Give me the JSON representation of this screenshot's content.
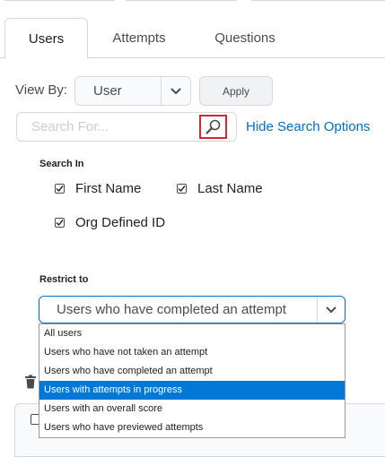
{
  "tabs": [
    {
      "label": "Users",
      "active": true
    },
    {
      "label": "Attempts",
      "active": false
    },
    {
      "label": "Questions",
      "active": false
    }
  ],
  "view_by": {
    "label": "View By:",
    "selected": "User",
    "apply_label": "Apply"
  },
  "search": {
    "placeholder": "Search For...",
    "value": "",
    "icon": "magnifier-icon",
    "hide_options_label": "Hide Search Options"
  },
  "search_in": {
    "heading": "Search In",
    "options": [
      {
        "label": "First Name",
        "checked": true
      },
      {
        "label": "Last Name",
        "checked": true
      },
      {
        "label": "Org Defined ID",
        "checked": true
      }
    ]
  },
  "restrict": {
    "heading": "Restrict to",
    "selected": "Users who have completed an attempt",
    "options": [
      "All users",
      "Users who have not taken an attempt",
      "Users who have completed an attempt",
      "Users with attempts in progress",
      "Users with an overall score",
      "Users who have previewed attempts"
    ],
    "highlighted": "Users with attempts in progress"
  },
  "colors": {
    "link": "#006fbf",
    "highlight": "#0078d7",
    "focus_outline": "#d6262f",
    "border": "#d3d9e3"
  }
}
